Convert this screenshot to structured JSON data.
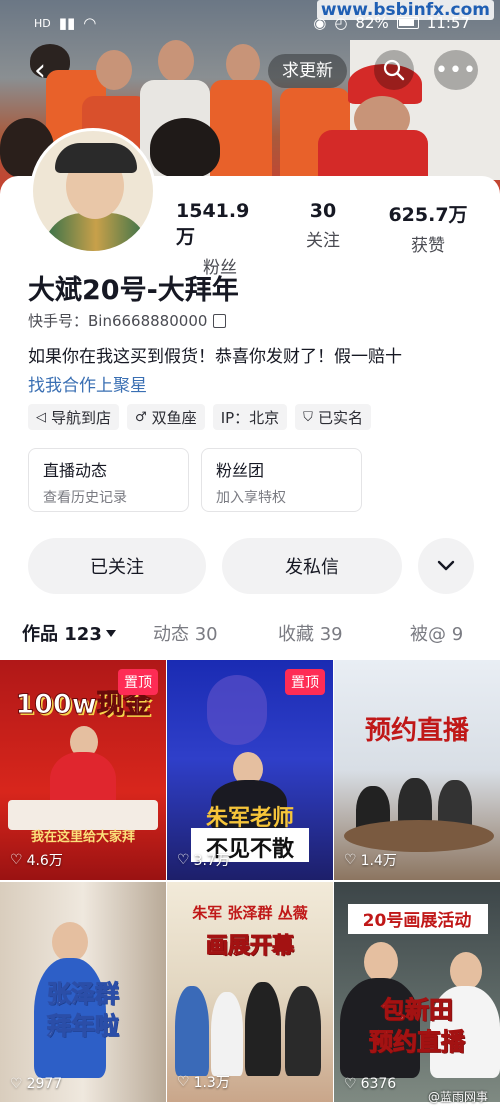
{
  "status_bar": {
    "battery": "82%",
    "time": "11:57",
    "site_watermark": "www.bsbinfx.com"
  },
  "header": {
    "refresh_label": "求更新"
  },
  "profile": {
    "followers_num": "1541.9万",
    "followers_label": "粉丝",
    "following_num": "30",
    "following_label": "关注",
    "likes_num": "625.7万",
    "likes_label": "获赞",
    "name": "大斌20号-大拜年",
    "uid": "快手号：Bin6668880000",
    "bio": "如果你在我这买到假货！恭喜你发财了！假一赔十",
    "biz_link": "找我合作上聚星",
    "tags": [
      "导航到店",
      "双鱼座",
      "IP：北京",
      "已实名"
    ]
  },
  "cards": [
    {
      "title": "直播动态",
      "sub": "查看历史记录"
    },
    {
      "title": "粉丝团",
      "sub": "加入享特权"
    }
  ],
  "actions": {
    "followed": "已关注",
    "message": "发私信"
  },
  "tabs": {
    "works": "作品 123",
    "moments": "动态 30",
    "favorites": "收藏 39",
    "mentioned": "被@ 9"
  },
  "videos": [
    {
      "caption": "100w现金",
      "sub_caption": "我在这里给大家拜",
      "likes": "4.6万",
      "pinned": "置顶"
    },
    {
      "caption": "朱军老师",
      "sub_caption": "不见不散",
      "likes": "3.7万",
      "pinned": "置顶"
    },
    {
      "caption": "预约直播",
      "likes": "1.4万"
    },
    {
      "caption": "张泽群",
      "sub_caption": "拜年啦",
      "likes": "2977"
    },
    {
      "caption": "朱军 张泽群 丛薇",
      "sub_caption": "画展开幕",
      "likes": "1.3万"
    },
    {
      "caption": "20号画展活动",
      "sub_caption": "包新田",
      "sub_caption2": "预约直播",
      "likes": "6376"
    }
  ],
  "bottom_watermark": "@蓝雨网事"
}
